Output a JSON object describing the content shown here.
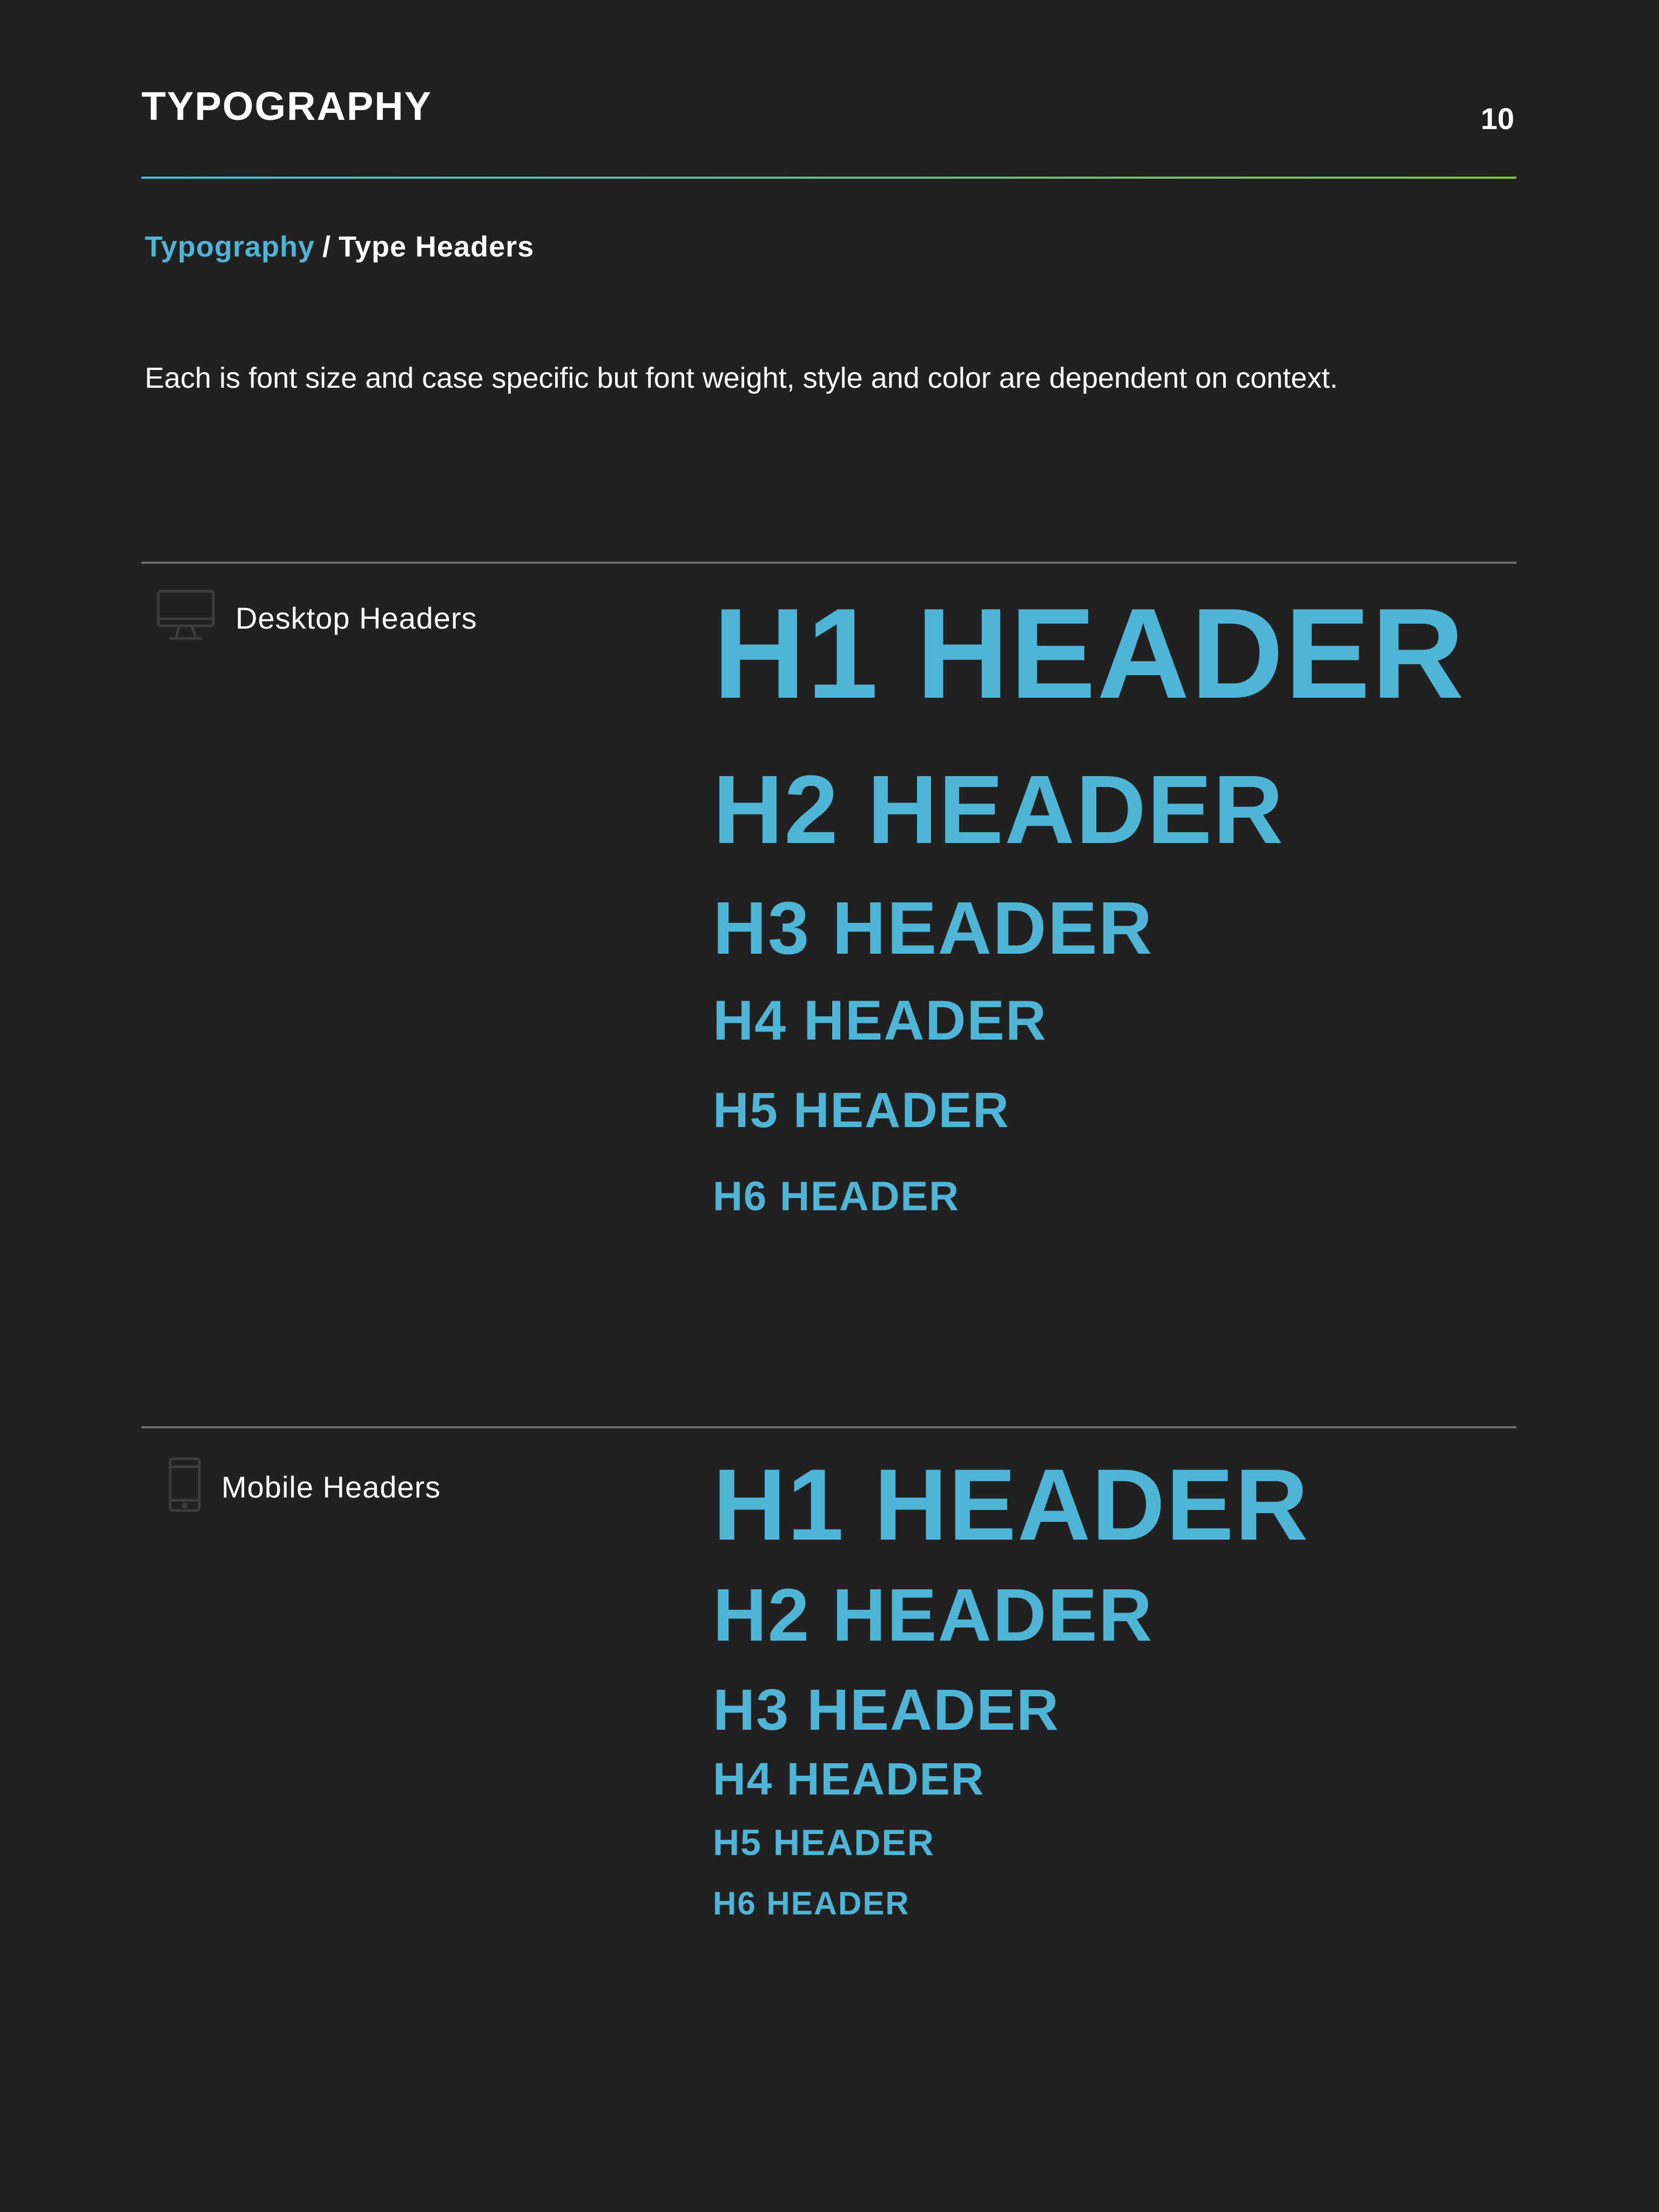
{
  "header": {
    "title": "TYPOGRAPHY",
    "page_number": "10"
  },
  "breadcrumb": {
    "parent": "Typography",
    "separator": "/",
    "current": "Type Headers"
  },
  "intro": "Each is font size and case specific but font weight, style and color are dependent on context.",
  "colors": {
    "background": "#212121",
    "accent_blue": "#4fb4d6",
    "accent_green": "#7cc142",
    "rule_gray": "#6e6e6e"
  },
  "desktop": {
    "label": "Desktop Headers",
    "icon": "desktop-monitor-icon",
    "headers": [
      "H1 HEADER",
      "H2 HEADER",
      "H3 HEADER",
      "H4 HEADER",
      "H5 HEADER",
      "H6 HEADER"
    ]
  },
  "mobile": {
    "label": "Mobile Headers",
    "icon": "mobile-phone-icon",
    "headers": [
      "H1 HEADER",
      "H2 HEADER",
      "H3 HEADER",
      "H4 HEADER",
      "H5 HEADER",
      "H6 HEADER"
    ]
  }
}
